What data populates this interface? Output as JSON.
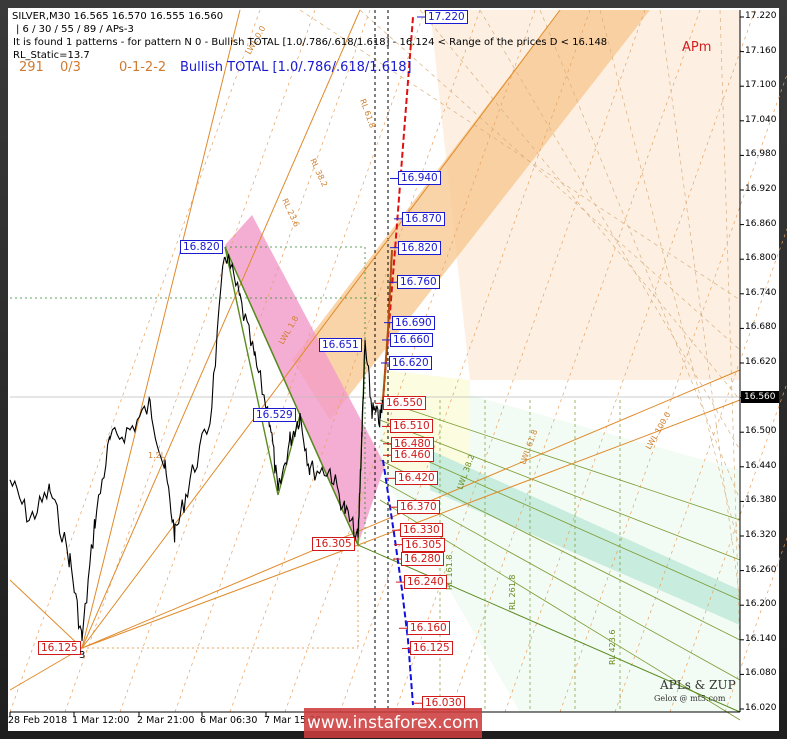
{
  "header": {
    "symbol_line": "SILVER,M30  16.565 16.570 16.555 16.560",
    "params": "| 6 / 30 / 55 / 89 / APs-3",
    "found": "It is found 1 patterns  -  for pattern N 0 - Bullish TOTAL [1.0/.786/.618/1.618] - 16.124 < Range of the prices D < 16.148",
    "rl_static": "RL_Static=13.7",
    "count": "291",
    "ratio": "0/3",
    "seq": "0-1-2-2",
    "pattern": "Bullish TOTAL [1.0/.786/.618/1.618]"
  },
  "apm_label": "APm",
  "branding": {
    "title": "APLs & ZUP",
    "subtitle": "Gelox @ mt5.com"
  },
  "watermark": "www.instaforex.com",
  "current_price": "16.560",
  "colors": {
    "blue": "#1a1ad0",
    "red": "#d01a1a",
    "orange": "#e08a2a",
    "green": "#6a8a20",
    "pink": "#f29ac8"
  },
  "chart_data": {
    "type": "line",
    "title": "SILVER,M30",
    "ylim": [
      16.02,
      17.22
    ],
    "y_ticks": [
      "17.220",
      "17.160",
      "17.100",
      "17.040",
      "16.980",
      "16.920",
      "16.860",
      "16.800",
      "16.740",
      "16.680",
      "16.620",
      "16.560",
      "16.500",
      "16.440",
      "16.380",
      "16.320",
      "16.260",
      "16.200",
      "16.140",
      "16.080",
      "16.020"
    ],
    "x_ticks": [
      "28 Feb 2018",
      "1 Mar 12:00",
      "2 Mar 21:00",
      "6 Mar 06:30",
      "7 Mar 15:30"
    ],
    "pivot_labels": [
      {
        "value": "16.820",
        "color": "blue"
      },
      {
        "value": "16.651",
        "color": "blue"
      },
      {
        "value": "16.529",
        "color": "blue"
      },
      {
        "value": "16.305",
        "color": "red"
      },
      {
        "value": "16.125",
        "color": "red"
      }
    ],
    "target_levels": [
      {
        "value": "17.220",
        "color": "blue"
      },
      {
        "value": "16.940",
        "color": "blue"
      },
      {
        "value": "16.870",
        "color": "blue"
      },
      {
        "value": "16.820",
        "color": "blue"
      },
      {
        "value": "16.760",
        "color": "blue"
      },
      {
        "value": "16.690",
        "color": "blue"
      },
      {
        "value": "16.660",
        "color": "blue"
      },
      {
        "value": "16.620",
        "color": "blue"
      },
      {
        "value": "16.550",
        "color": "red"
      },
      {
        "value": "16.510",
        "color": "red"
      },
      {
        "value": "16.480",
        "color": "red"
      },
      {
        "value": "16.460",
        "color": "red"
      },
      {
        "value": "16.420",
        "color": "red"
      },
      {
        "value": "16.370",
        "color": "red"
      },
      {
        "value": "16.330",
        "color": "red"
      },
      {
        "value": "16.305",
        "color": "red"
      },
      {
        "value": "16.280",
        "color": "red"
      },
      {
        "value": "16.240",
        "color": "red"
      },
      {
        "value": "16.160",
        "color": "red"
      },
      {
        "value": "16.125",
        "color": "red"
      },
      {
        "value": "16.030",
        "color": "red"
      }
    ],
    "line_labels": [
      "RL 61.8",
      "RL 38.2",
      "RL 23.6",
      "LWL 0.0",
      "LWL 100.0",
      "LWL 61.8",
      "LWL 38.2",
      "RL 161.8",
      "RL 261.8",
      "RL 423.6",
      "LWL 1.8",
      "1.2L"
    ],
    "pivot_marker": "3"
  }
}
